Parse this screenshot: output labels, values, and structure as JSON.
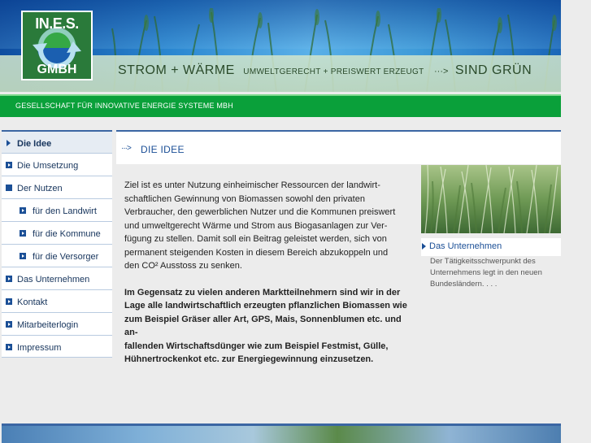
{
  "logo": {
    "line1": "IN.E.S.",
    "line2": "GMBH"
  },
  "slogan": {
    "part1": "STROM + WÄRME",
    "part2": "UMWELTGERECHT + PREISWERT ERZEUGT",
    "arrow": "···>",
    "part3": "SIND GRÜN"
  },
  "company_bar": "GESELLSCHAFT FÜR INNOVATIVE ENERGIE SYSTEME MBH",
  "nav": {
    "items": [
      {
        "label": "Die Idee"
      },
      {
        "label": "Die Umsetzung"
      },
      {
        "label": "Der Nutzen"
      },
      {
        "label": "für den Landwirt"
      },
      {
        "label": "für die Kommune"
      },
      {
        "label": "für die Versorger"
      },
      {
        "label": "Das Unternehmen"
      },
      {
        "label": "Kontakt"
      },
      {
        "label": "Mitarbeiterlogin"
      },
      {
        "label": "Impressum"
      }
    ]
  },
  "content": {
    "arrow": "···>",
    "title": "DIE IDEE",
    "paragraph1_lines": [
      "Ziel ist es unter Nutzung einheimischer Ressourcen der landwirt-",
      "schaftlichen Gewinnung von Biomassen sowohl den privaten",
      "Verbraucher, den gewerblichen Nutzer und die Kommunen preiswert",
      "und umweltgerecht Wärme und Strom aus Biogasanlagen zur Ver-",
      "fügung zu stellen. Damit soll ein Beitrag geleistet werden, sich von",
      "permanent steigenden Kosten in diesem Bereich abzukoppeln und",
      "den CO² Ausstoss zu senken."
    ],
    "paragraph2_lines": [
      "Im Gegensatz zu vielen anderen Marktteilnehmern sind wir in der",
      "Lage alle landwirtschaftlich erzeugten pflanzlichen Biomassen wie",
      "zum Beispiel Gräser aller Art, GPS, Mais, Sonnenblumen etc. und an-",
      "fallenden Wirtschaftsdünger wie zum Beispiel Festmist, Gülle,",
      "Hühnertrockenkot etc. zur Energiegewinnung einzusetzen."
    ]
  },
  "sidebar": {
    "link_label": "Das Unternehmen",
    "text_lines": [
      "Der Tätigkeitsschwerpunkt des",
      "Unternehmens legt in den neuen",
      "Bundesländern. . . ."
    ]
  },
  "colors": {
    "nav_blue": "#1b4f96",
    "green_bar": "#0aa03a",
    "rule_blue": "#3b66a3"
  }
}
